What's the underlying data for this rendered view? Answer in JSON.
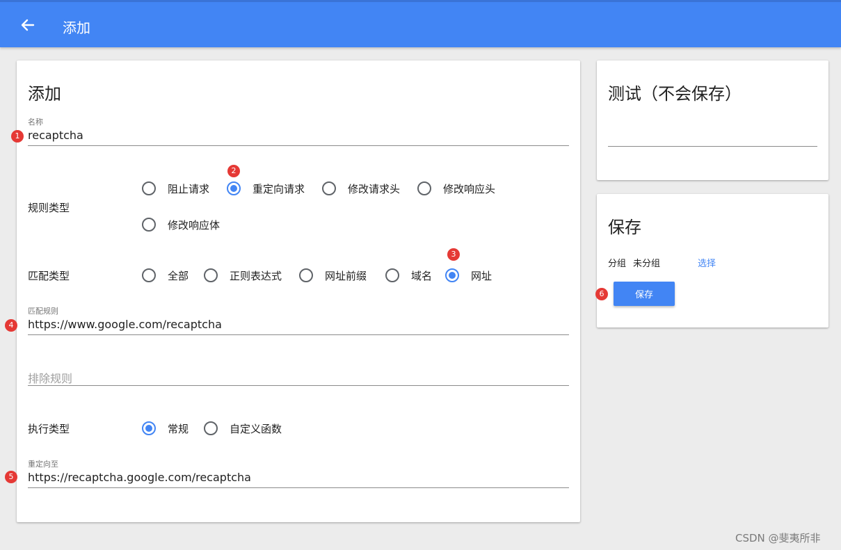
{
  "appbar": {
    "title": "添加"
  },
  "main_card": {
    "title": "添加",
    "name_field": {
      "label": "名称",
      "value": "recaptcha"
    },
    "rule_type": {
      "label": "规则类型",
      "options": [
        "阻止请求",
        "重定向请求",
        "修改请求头",
        "修改响应头",
        "修改响应体"
      ],
      "selected": "重定向请求"
    },
    "match_type": {
      "label": "匹配类型",
      "options": [
        "全部",
        "正则表达式",
        "网址前缀",
        "域名",
        "网址"
      ],
      "selected": "网址"
    },
    "match_rule": {
      "label": "匹配规则",
      "value": "https://www.google.com/recaptcha"
    },
    "exclude_rule": {
      "placeholder": "排除规则"
    },
    "exec_type": {
      "label": "执行类型",
      "options": [
        "常规",
        "自定义函数"
      ],
      "selected": "常规"
    },
    "redirect_to": {
      "label": "重定向至",
      "value": "https://recaptcha.google.com/recaptcha"
    }
  },
  "test_card": {
    "title": "测试（不会保存）"
  },
  "save_card": {
    "title": "保存",
    "group_label": "分组",
    "group_value": "未分组",
    "choose_link": "选择",
    "save_button": "保存"
  },
  "markers": [
    "1",
    "2",
    "3",
    "4",
    "5",
    "6"
  ],
  "watermark": "CSDN @斐夷所非",
  "colors": {
    "accent": "#4285f4",
    "marker": "#e53935"
  }
}
